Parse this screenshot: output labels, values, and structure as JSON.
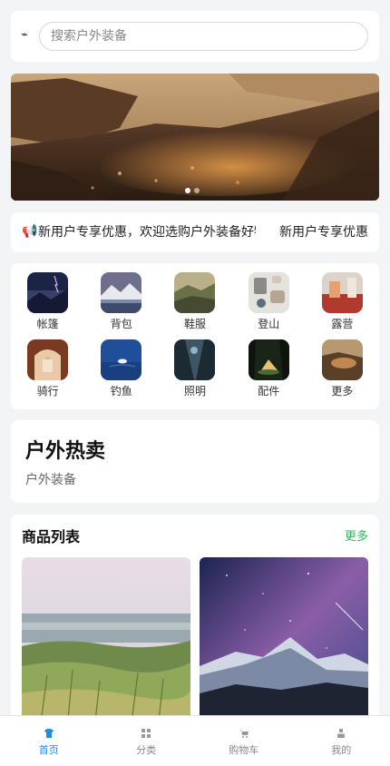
{
  "search": {
    "placeholder": "搜索户外装备"
  },
  "banner": {
    "slide_count": 2,
    "active_index": 0
  },
  "notice": {
    "text": "新用户专享优惠，欢迎选购户外装备好物！",
    "tag": "新用户专享优惠"
  },
  "categories": [
    {
      "label": "帐篷"
    },
    {
      "label": "背包"
    },
    {
      "label": "鞋服"
    },
    {
      "label": "登山"
    },
    {
      "label": "露营"
    },
    {
      "label": "骑行"
    },
    {
      "label": "钓鱼"
    },
    {
      "label": "照明"
    },
    {
      "label": "配件"
    },
    {
      "label": "更多"
    }
  ],
  "hot": {
    "title": "户外热卖",
    "subtitle": "户外装备"
  },
  "product_list": {
    "title": "商品列表",
    "more_label": "更多"
  },
  "tabs": [
    {
      "label": "首页",
      "icon": "shirt-icon",
      "active": true
    },
    {
      "label": "分类",
      "icon": "grid-icon",
      "active": false
    },
    {
      "label": "购物车",
      "icon": "cart-icon",
      "active": false
    },
    {
      "label": "我的",
      "icon": "user-icon",
      "active": false
    }
  ],
  "colors": {
    "accent_green": "#2db55d",
    "tab_active": "#1f8fdb",
    "tab_inactive": "#888888"
  }
}
